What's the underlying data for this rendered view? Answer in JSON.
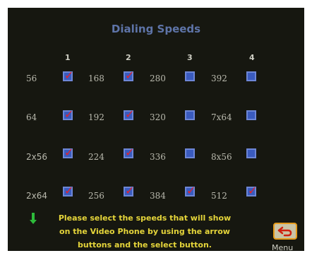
{
  "screen": {
    "title": "Dialing Speeds"
  },
  "columns": [
    "1",
    "2",
    "3",
    "4"
  ],
  "rows": [
    [
      {
        "speed": "56",
        "checked": true
      },
      {
        "speed": "168",
        "checked": true
      },
      {
        "speed": "280",
        "checked": false
      },
      {
        "speed": "392",
        "checked": false
      }
    ],
    [
      {
        "speed": "64",
        "checked": true
      },
      {
        "speed": "192",
        "checked": true
      },
      {
        "speed": "320",
        "checked": false
      },
      {
        "speed": "7x64",
        "checked": false
      }
    ],
    [
      {
        "speed": "2x56",
        "checked": true
      },
      {
        "speed": "224",
        "checked": true
      },
      {
        "speed": "336",
        "checked": false
      },
      {
        "speed": "8x56",
        "checked": false
      }
    ],
    [
      {
        "speed": "2x64",
        "checked": true
      },
      {
        "speed": "256",
        "checked": true
      },
      {
        "speed": "384",
        "checked": true
      },
      {
        "speed": "512",
        "checked": true
      }
    ]
  ],
  "help_text": {
    "line1": "Please select the speeds that will show",
    "line2": "on the Video Phone by using the arrow",
    "line3": "buttons and the select button."
  },
  "menu": {
    "label": "Menu"
  },
  "icons": {
    "hint": "down-arrow-icon",
    "menu": "return-arrow-icon"
  },
  "colors": {
    "background": "#161710",
    "title": "#5e74a8",
    "help": "#e5d53a",
    "checkbox": "#3a5bbf",
    "check": "#e0242e"
  }
}
